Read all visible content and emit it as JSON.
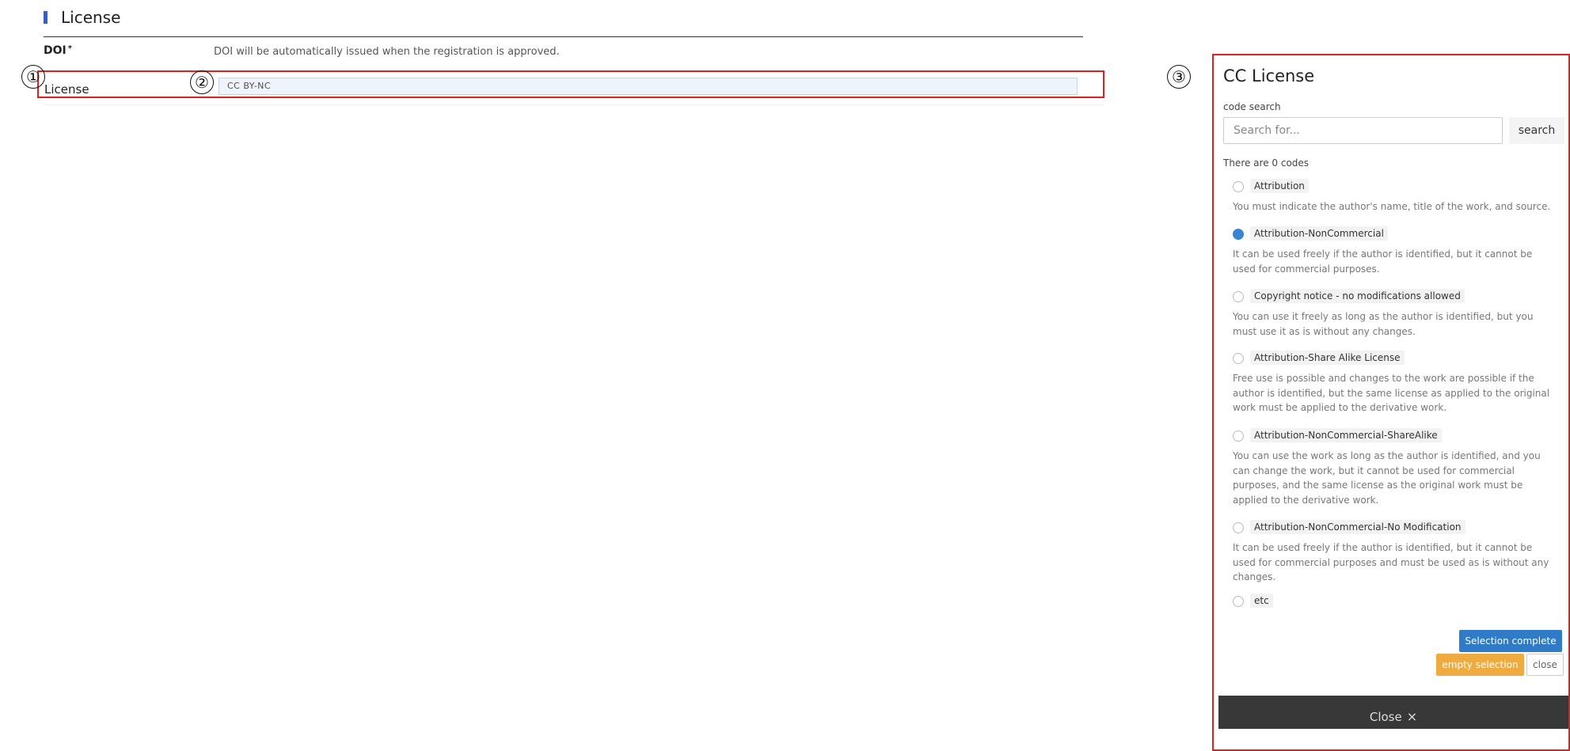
{
  "form": {
    "section_title": "License",
    "doi_label": "DOI",
    "doi_required": "*",
    "doi_value": "DOI will be automatically issued when the registration is approved.",
    "license_label": "License",
    "license_value": "CC BY-NC"
  },
  "markers": [
    "①",
    "②",
    "③"
  ],
  "panel": {
    "title": "CC License",
    "search_label": "code search",
    "search_placeholder": "Search for...",
    "search_button": "search",
    "count_text": "There are 0 codes",
    "options": [
      {
        "label": "Attribution",
        "desc": "You must indicate the author's name, title of the work, and source.",
        "selected": false
      },
      {
        "label": "Attribution-NonCommercial",
        "desc": "It can be used freely if the author is identified, but it cannot be used for commercial purposes.",
        "selected": true
      },
      {
        "label": "Copyright notice - no modifications allowed",
        "desc": "You can use it freely as long as the author is identified, but you must use it as is without any changes.",
        "selected": false
      },
      {
        "label": "Attribution-Share Alike License",
        "desc": "Free use is possible and changes to the work are possible if the author is identified, but the same license as applied to the original work must be applied to the derivative work.",
        "selected": false
      },
      {
        "label": "Attribution-NonCommercial-ShareAlike",
        "desc": "You can use the work as long as the author is identified, and you can change the work, but it cannot be used for commercial purposes, and the same license as the original work must be applied to the derivative work.",
        "selected": false
      },
      {
        "label": "Attribution-NonCommercial-No Modification",
        "desc": "It can be used freely if the author is identified, but it cannot be used for commercial purposes and must be used as is without any changes.",
        "selected": false
      },
      {
        "label": "etc",
        "desc": "",
        "selected": false
      }
    ],
    "btn_complete": "Selection complete",
    "btn_empty": "empty selection",
    "btn_close": "close",
    "close_bar": "Close",
    "close_icon": "×"
  },
  "colors": {
    "accent": "#2f7bc7",
    "warning": "#f0ab40",
    "highlight_border": "#e02020",
    "section_bar": "#2f5fd0"
  }
}
